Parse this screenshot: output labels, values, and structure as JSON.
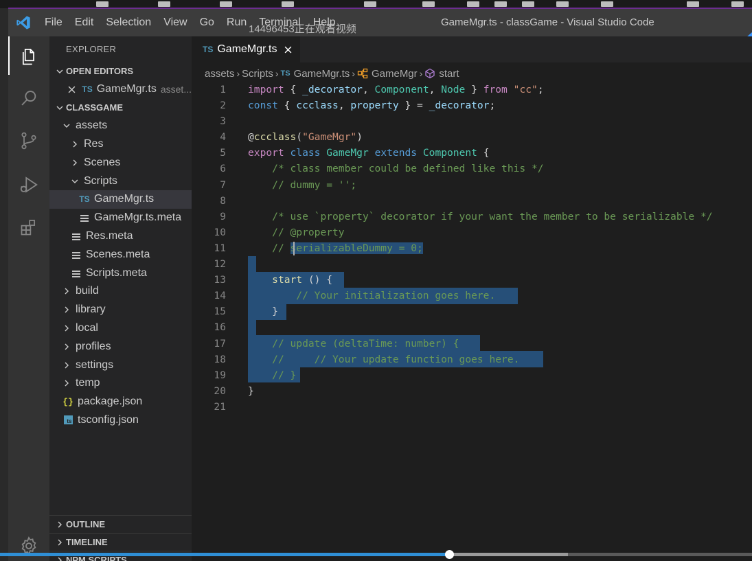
{
  "titlebar": {
    "menu": [
      "File",
      "Edit",
      "Selection",
      "View",
      "Go",
      "Run",
      "Terminal",
      "Help"
    ],
    "window_title": "GameMgr.ts - classGame - Visual Studio Code",
    "watermark": "14496453正在观看视频"
  },
  "activitybar": {
    "icons": [
      "files-icon",
      "search-icon",
      "source-control-icon",
      "run-debug-icon",
      "extensions-icon",
      "settings-gear-icon"
    ]
  },
  "sidebar": {
    "title": "EXPLORER",
    "open_editors": {
      "header": "OPEN EDITORS",
      "items": [
        {
          "name": "GameMgr.ts",
          "path": "asset..."
        }
      ]
    },
    "workspace": {
      "header": "CLASSGAME",
      "items": [
        {
          "label": "assets",
          "type": "folder-open",
          "depth": 1
        },
        {
          "label": "Res",
          "type": "folder",
          "depth": 2
        },
        {
          "label": "Scenes",
          "type": "folder",
          "depth": 2
        },
        {
          "label": "Scripts",
          "type": "folder-open",
          "depth": 2
        },
        {
          "label": "GameMgr.ts",
          "type": "ts",
          "depth": 3,
          "selected": true
        },
        {
          "label": "GameMgr.ts.meta",
          "type": "meta",
          "depth": 3
        },
        {
          "label": "Res.meta",
          "type": "meta",
          "depth": 2
        },
        {
          "label": "Scenes.meta",
          "type": "meta",
          "depth": 2
        },
        {
          "label": "Scripts.meta",
          "type": "meta",
          "depth": 2
        },
        {
          "label": "build",
          "type": "folder",
          "depth": 1
        },
        {
          "label": "library",
          "type": "folder",
          "depth": 1
        },
        {
          "label": "local",
          "type": "folder",
          "depth": 1
        },
        {
          "label": "profiles",
          "type": "folder",
          "depth": 1
        },
        {
          "label": "settings",
          "type": "folder",
          "depth": 1
        },
        {
          "label": "temp",
          "type": "folder",
          "depth": 1
        },
        {
          "label": "package.json",
          "type": "json",
          "depth": 1
        },
        {
          "label": "tsconfig.json",
          "type": "tsconfig",
          "depth": 1
        }
      ]
    },
    "outline_header": "OUTLINE",
    "timeline_header": "TIMELINE",
    "npm_header": "NPM SCRIPTS"
  },
  "editor": {
    "tab": {
      "label": "GameMgr.ts",
      "lang_badge": "TS"
    },
    "breadcrumb": [
      "assets",
      "Scripts",
      "GameMgr.ts",
      "GameMgr",
      "start"
    ],
    "lines": [
      [
        [
          "kw2",
          "import"
        ],
        [
          "plain",
          " { "
        ],
        [
          "var",
          "_decorator"
        ],
        [
          "plain",
          ", "
        ],
        [
          "cls",
          "Component"
        ],
        [
          "plain",
          ", "
        ],
        [
          "cls",
          "Node"
        ],
        [
          "plain",
          " } "
        ],
        [
          "kw2",
          "from"
        ],
        [
          "plain",
          " "
        ],
        [
          "str",
          "\"cc\""
        ],
        [
          "plain",
          ";"
        ]
      ],
      [
        [
          "kw",
          "const"
        ],
        [
          "plain",
          " { "
        ],
        [
          "var",
          "ccclass"
        ],
        [
          "plain",
          ", "
        ],
        [
          "var",
          "property"
        ],
        [
          "plain",
          " } = "
        ],
        [
          "var",
          "_decorator"
        ],
        [
          "plain",
          ";"
        ]
      ],
      [],
      [
        [
          "plain",
          "@"
        ],
        [
          "fn",
          "ccclass"
        ],
        [
          "plain",
          "("
        ],
        [
          "str",
          "\"GameMgr\""
        ],
        [
          "plain",
          ")"
        ]
      ],
      [
        [
          "kw2",
          "export"
        ],
        [
          "plain",
          " "
        ],
        [
          "kw",
          "class"
        ],
        [
          "plain",
          " "
        ],
        [
          "cls",
          "GameMgr"
        ],
        [
          "plain",
          " "
        ],
        [
          "kw",
          "extends"
        ],
        [
          "plain",
          " "
        ],
        [
          "cls",
          "Component"
        ],
        [
          "plain",
          " {"
        ]
      ],
      [
        [
          "plain",
          "    "
        ],
        [
          "cmt",
          "/* class member could be defined like this */"
        ]
      ],
      [
        [
          "plain",
          "    "
        ],
        [
          "cmt",
          "// dummy = '';"
        ]
      ],
      [],
      [
        [
          "plain",
          "    "
        ],
        [
          "cmt",
          "/* use `property` decorator if your want the member to be serializable */"
        ]
      ],
      [
        [
          "plain",
          "    "
        ],
        [
          "cmt",
          "// @property"
        ]
      ],
      [
        [
          "plain",
          "    "
        ],
        [
          "cmt",
          "// "
        ],
        [
          "cmt sel",
          "serializableDummy = 0;"
        ]
      ],
      [],
      [
        [
          "plain",
          "    "
        ],
        [
          "fn",
          "start"
        ],
        [
          "plain",
          " () {"
        ]
      ],
      [
        [
          "plain",
          "        "
        ],
        [
          "cmt",
          "// Your initialization goes here."
        ]
      ],
      [
        [
          "plain",
          "    }"
        ]
      ],
      [],
      [
        [
          "plain",
          "    "
        ],
        [
          "cmt",
          "// update (deltaTime: number) {"
        ]
      ],
      [
        [
          "plain",
          "    "
        ],
        [
          "cmt",
          "//     // Your update function goes here."
        ]
      ],
      [
        [
          "plain",
          "    "
        ],
        [
          "cmt",
          "// }"
        ]
      ],
      [
        [
          "plain",
          "}"
        ]
      ],
      []
    ]
  },
  "video": {
    "progress": 0.597,
    "buffered": 0.755
  }
}
